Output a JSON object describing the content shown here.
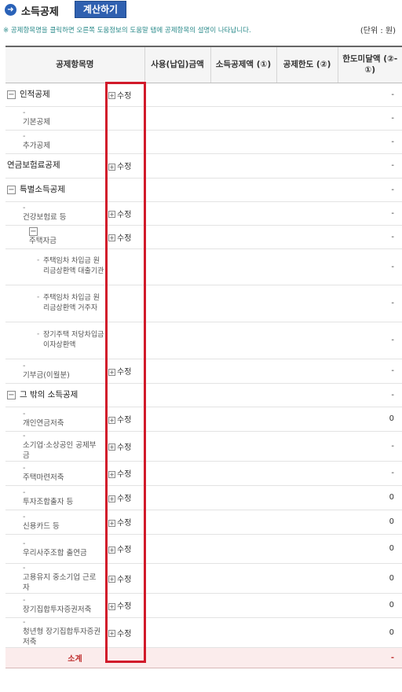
{
  "header": {
    "title": "소득공제",
    "calc_button": "계산하기",
    "notice": "※ 공제항목명을 클릭하면 오른쪽 도움정보의 도움말 탭에 공제항목의 설명이 나타납니다.",
    "unit": "(단위 : 원)"
  },
  "columns": {
    "name": "공제항목명",
    "amount": "사용(납입)금액",
    "deduction": "소득공제액 (①)",
    "limit": "공제한도 (②)",
    "remaining": "한도미달액 (②-①)"
  },
  "edit_label": "수정",
  "rows": [
    {
      "name": "인적공제",
      "level": 0,
      "toggle": "−",
      "edit": true,
      "remaining": "-"
    },
    {
      "name": "기본공제",
      "level": 1,
      "toggle": "",
      "edit": false,
      "remaining": "-"
    },
    {
      "name": "추가공제",
      "level": 1,
      "toggle": "",
      "edit": false,
      "remaining": "-"
    },
    {
      "name": "연금보험료공제",
      "level": 0,
      "toggle": "",
      "edit": true,
      "remaining": "-"
    },
    {
      "name": "특별소득공제",
      "level": 0,
      "toggle": "−",
      "edit": false,
      "remaining": "-"
    },
    {
      "name": "건강보험료 등",
      "level": 1,
      "toggle": "",
      "edit": true,
      "remaining": "-"
    },
    {
      "name": "주택자금",
      "level": 2,
      "toggle": "−",
      "edit": true,
      "remaining": "-"
    },
    {
      "name": "주택임차 차입금 원리금상환액 대출기관",
      "level": 3,
      "toggle": "",
      "edit": false,
      "remaining": "-"
    },
    {
      "name": "주택임차 차입금 원리금상환액 거주자",
      "level": 3,
      "toggle": "",
      "edit": false,
      "remaining": "-"
    },
    {
      "name": "장기주택 저당차입금 이자상환액",
      "level": 3,
      "toggle": "",
      "edit": false,
      "remaining": "-"
    },
    {
      "name": "기부금(이월분)",
      "level": 1,
      "toggle": "",
      "edit": true,
      "remaining": "-"
    },
    {
      "name": "그 밖의 소득공제",
      "level": 0,
      "toggle": "−",
      "edit": false,
      "remaining": "-"
    },
    {
      "name": "개인연금저축",
      "level": 1,
      "toggle": "",
      "edit": true,
      "remaining": "0"
    },
    {
      "name": "소기업·소상공인 공제부금",
      "level": 1,
      "toggle": "",
      "edit": true,
      "remaining": "-"
    },
    {
      "name": "주택마련저축",
      "level": 1,
      "toggle": "",
      "edit": true,
      "remaining": "-"
    },
    {
      "name": "투자조합출자 등",
      "level": 1,
      "toggle": "",
      "edit": true,
      "remaining": "0"
    },
    {
      "name": "신용카드 등",
      "level": 1,
      "toggle": "",
      "edit": true,
      "remaining": "0"
    },
    {
      "name": "우리사주조합 출연금",
      "level": 1,
      "toggle": "",
      "edit": true,
      "remaining": "0"
    },
    {
      "name": "고용유지 중소기업 근로자",
      "level": 1,
      "toggle": "",
      "edit": true,
      "remaining": "0"
    },
    {
      "name": "장기집합투자증권저축",
      "level": 1,
      "toggle": "",
      "edit": true,
      "remaining": "0"
    },
    {
      "name": "청년형 장기집합투자증권저축",
      "level": 1,
      "toggle": "",
      "edit": true,
      "remaining": "0"
    }
  ],
  "total": {
    "label": "소계",
    "remaining": "-"
  }
}
